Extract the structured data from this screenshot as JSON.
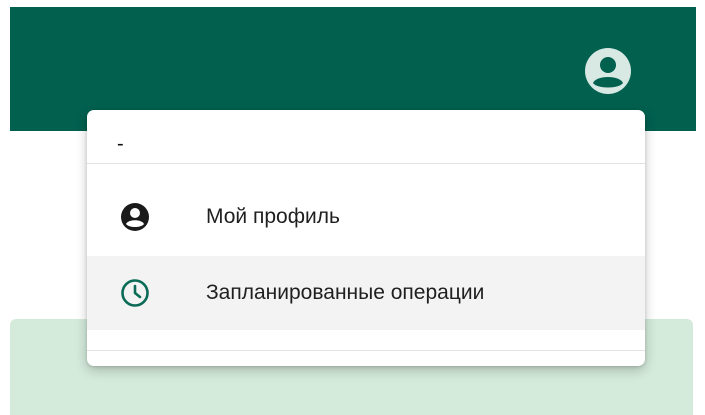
{
  "header": {
    "avatar_icon": "account-circle-icon"
  },
  "user_menu": {
    "user_name": "-",
    "items": [
      {
        "label": "Мой профиль",
        "icon": "account-circle-icon"
      },
      {
        "label": "Запланированные операции",
        "icon": "clock-icon"
      }
    ]
  },
  "colors": {
    "topbar": "#02604f",
    "content_band": "#d4eadb",
    "accent": "#0b6b57",
    "hover": "#f3f3f3"
  }
}
